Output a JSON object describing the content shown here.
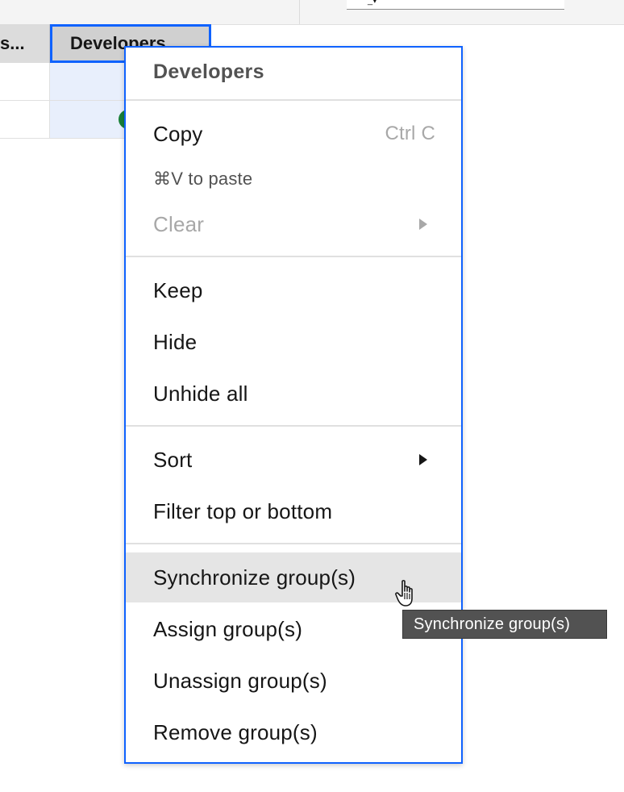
{
  "grid": {
    "prev_header": "s...",
    "active_header": "Developers"
  },
  "menu": {
    "title": "Developers",
    "items": [
      {
        "label": "Copy",
        "shortcut": "Ctrl C",
        "state": "normal"
      },
      {
        "label": "⌘V to paste",
        "state": "hint"
      },
      {
        "label": "Clear",
        "state": "disabled",
        "submenu": true
      },
      {
        "label": "Keep",
        "state": "normal"
      },
      {
        "label": "Hide",
        "state": "normal"
      },
      {
        "label": "Unhide all",
        "state": "normal"
      },
      {
        "label": "Sort",
        "state": "normal",
        "submenu": true
      },
      {
        "label": "Filter top or bottom",
        "state": "normal"
      },
      {
        "label": "Synchronize group(s)",
        "state": "hovered"
      },
      {
        "label": "Assign group(s)",
        "state": "normal"
      },
      {
        "label": "Unassign group(s)",
        "state": "normal"
      },
      {
        "label": "Remove group(s)",
        "state": "normal"
      }
    ]
  },
  "tooltip": {
    "text": "Synchronize group(s)"
  },
  "colors": {
    "accent": "#0f62fe",
    "status_green": "#198038",
    "hover_bg": "#e5e5e5",
    "tooltip_bg": "#525252"
  },
  "icons": {
    "cursor": "hand-pointer-icon",
    "submenu": "caret-right-icon"
  }
}
